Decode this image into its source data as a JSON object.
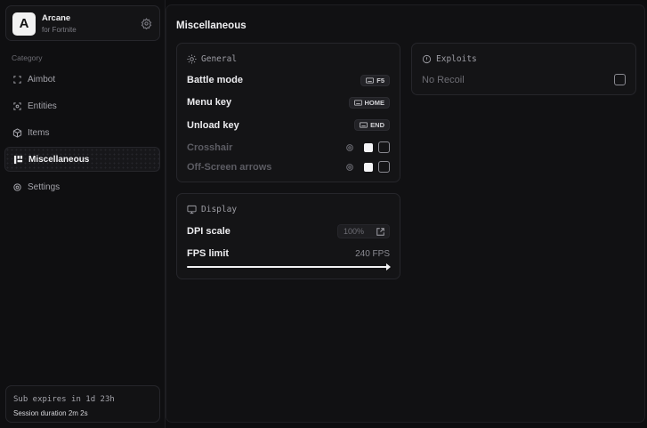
{
  "profile": {
    "initial": "A",
    "name": "Arcane",
    "subtitle": "for Fortnite"
  },
  "sidebar": {
    "category_label": "Category",
    "items": [
      {
        "label": "Aimbot",
        "icon": "crosshair-icon"
      },
      {
        "label": "Entities",
        "icon": "scan-face-icon"
      },
      {
        "label": "Items",
        "icon": "box-icon"
      },
      {
        "label": "Miscellaneous",
        "icon": "grid-icon",
        "active": true
      },
      {
        "label": "Settings",
        "icon": "gear-icon"
      }
    ]
  },
  "subscription": {
    "expires": "Sub expires in 1d 23h",
    "session": "Session duration  2m  2s"
  },
  "main": {
    "title": "Miscellaneous",
    "general": {
      "title": "General",
      "battle_mode": {
        "label": "Battle mode",
        "key": "F5"
      },
      "menu_key": {
        "label": "Menu key",
        "key": "HOME"
      },
      "unload_key": {
        "label": "Unload key",
        "key": "END"
      },
      "crosshair": {
        "label": "Crosshair",
        "enabled": false,
        "color": "#f5f5f7"
      },
      "offscreen": {
        "label": "Off-Screen arrows",
        "enabled": false,
        "color": "#f5f5f7"
      }
    },
    "display": {
      "title": "Display",
      "dpi": {
        "label": "DPI scale",
        "value": "100%"
      },
      "fps": {
        "label": "FPS limit",
        "value": "240 FPS",
        "fraction": 1.0
      }
    },
    "exploits": {
      "title": "Exploits",
      "no_recoil": {
        "label": "No Recoil",
        "enabled": false
      }
    }
  }
}
